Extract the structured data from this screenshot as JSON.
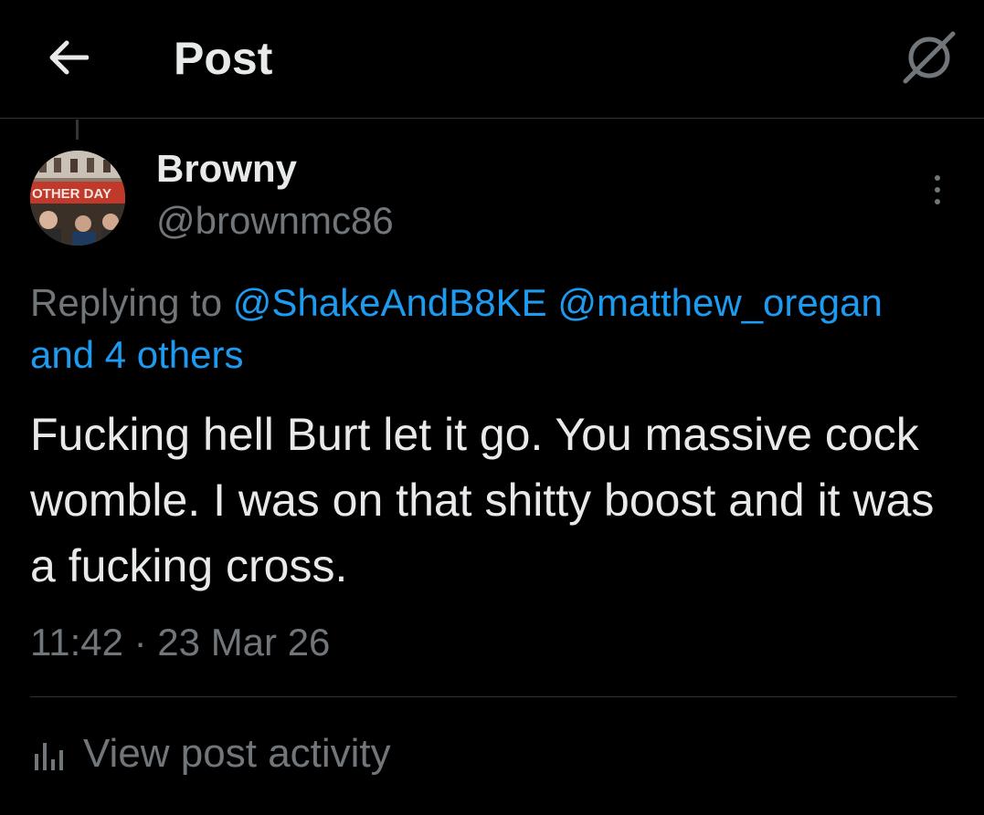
{
  "header": {
    "title": "Post",
    "back_icon": "arrow-left-icon",
    "grok_icon": "grok-icon"
  },
  "post": {
    "author": {
      "name": "Browny",
      "handle": "@brownmc86",
      "avatar_banner_text": "OTHER DAY"
    },
    "replying_prefix": "Replying to",
    "replying_to": [
      "@ShakeAndB8KE",
      "@matthew_oregan"
    ],
    "replying_more": "and 4 others",
    "text": "Fucking hell Burt let it go. You massive cock womble. I was on that shitty boost and it was a fucking cross.",
    "timestamp": "11:42 · 23 Mar 26",
    "activity_label": "View post activity"
  },
  "colors": {
    "background": "#000000",
    "text": "#e7e9ea",
    "secondary": "#71767b",
    "link": "#1d9bf0",
    "border": "#2f3336"
  }
}
